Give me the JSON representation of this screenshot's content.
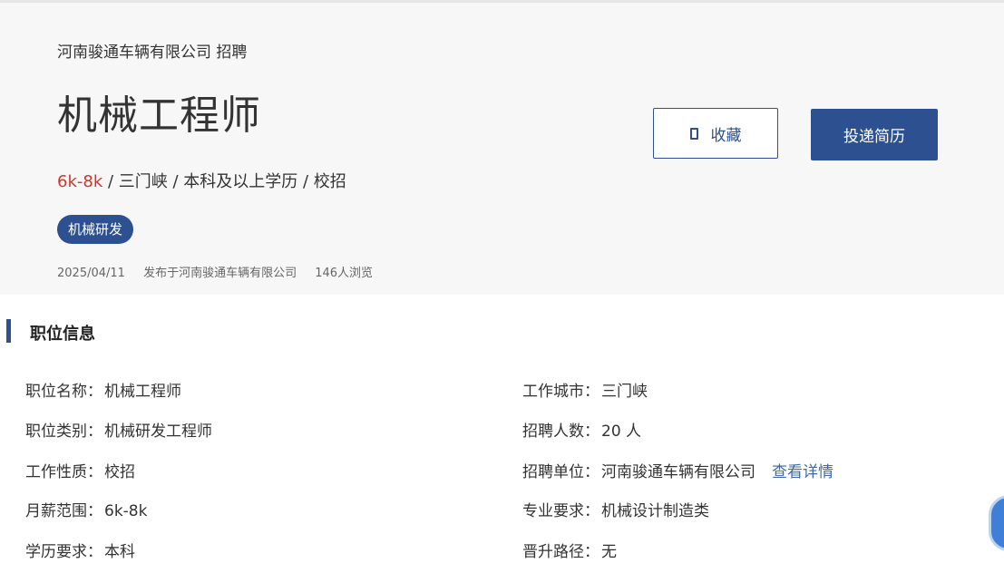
{
  "header": {
    "company_line": "河南骏通车辆有限公司 招聘",
    "job_title": "机械工程师",
    "salary": "6k-8k",
    "summary_rest": " / 三门峡 / 本科及以上学历 / 校招",
    "tag": "机械研发",
    "meta": {
      "date": "2025/04/11",
      "publisher": "发布于河南骏通车辆有限公司",
      "views": "146人浏览"
    }
  },
  "actions": {
    "favorite_label": "收藏",
    "apply_label": "投递简历"
  },
  "section": {
    "title": "职位信息"
  },
  "info_left": [
    {
      "label": "职位名称：",
      "value": "机械工程师"
    },
    {
      "label": "职位类别：",
      "value": "机械研发工程师"
    },
    {
      "label": "工作性质：",
      "value": "校招"
    },
    {
      "label": "月薪范围：",
      "value": "6k-8k"
    },
    {
      "label": "学历要求：",
      "value": "本科"
    }
  ],
  "info_right": [
    {
      "label": "工作城市：",
      "value": "三门峡"
    },
    {
      "label": "招聘人数：",
      "value": "20 人"
    },
    {
      "label": "招聘单位：",
      "value": "河南骏通车辆有限公司",
      "link": "查看详情"
    },
    {
      "label": "专业要求：",
      "value": "机械设计制造类"
    },
    {
      "label": "晋升路径：",
      "value": "无"
    }
  ],
  "colors": {
    "accent": "#2d5190",
    "salary": "#d0342c",
    "link": "#3d6aa7"
  },
  "icons": {
    "favorite": "bookmark-icon"
  }
}
